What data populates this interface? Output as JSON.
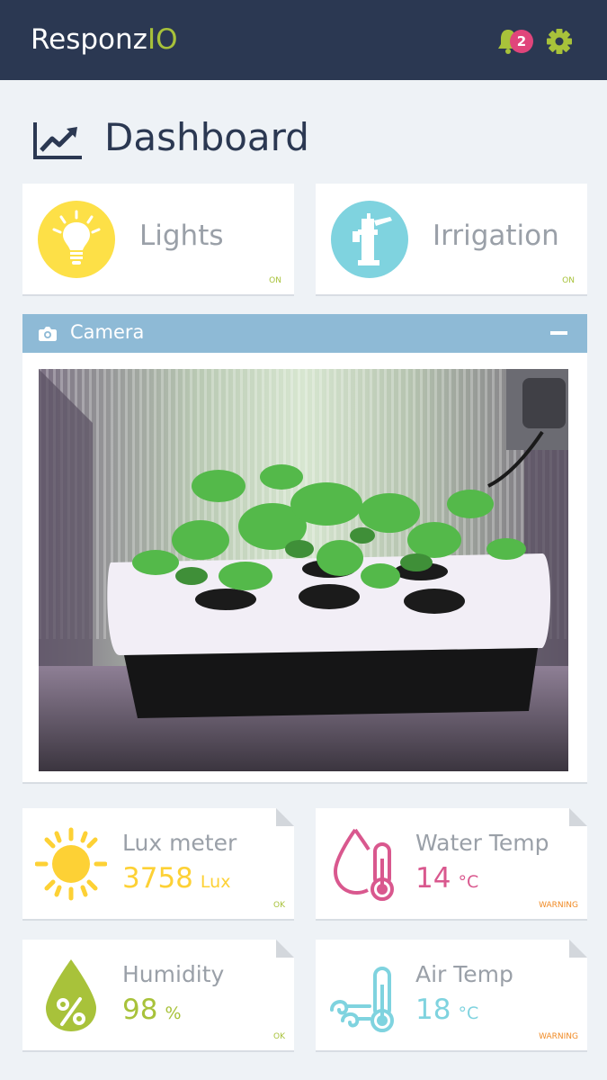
{
  "app": {
    "brand_main": "Responz",
    "brand_accent": "IO",
    "notification_count": "2"
  },
  "page": {
    "title": "Dashboard"
  },
  "toggles": [
    {
      "label": "Lights",
      "status": "ON",
      "color": "#fde047",
      "icon": "lightbulb-icon"
    },
    {
      "label": "Irrigation",
      "status": "ON",
      "color": "#7fd3df",
      "icon": "water-pump-icon"
    }
  ],
  "camera": {
    "title": "Camera",
    "icon": "camera-icon"
  },
  "sensors": [
    {
      "label": "Lux meter",
      "value": "3758",
      "unit": "Lux",
      "status": "OK",
      "color": "#fdd135",
      "status_color": "#a8c23a",
      "icon": "sun-icon"
    },
    {
      "label": "Water Temp",
      "value": "14",
      "unit": "°C",
      "status": "WARNING",
      "color": "#d9588e",
      "status_color": "#f08a24",
      "icon": "water-temperature-icon"
    },
    {
      "label": "Humidity",
      "value": "98",
      "unit": "%",
      "status": "OK",
      "color": "#a8c23a",
      "status_color": "#a8c23a",
      "icon": "humidity-drop-icon"
    },
    {
      "label": "Air Temp",
      "value": "18",
      "unit": "°C",
      "status": "WARNING",
      "color": "#7fd3df",
      "status_color": "#f08a24",
      "icon": "air-temperature-icon"
    }
  ],
  "colors": {
    "header": "#2b3852",
    "accent": "#a8c23a",
    "camera_bar": "#8ebad6"
  }
}
